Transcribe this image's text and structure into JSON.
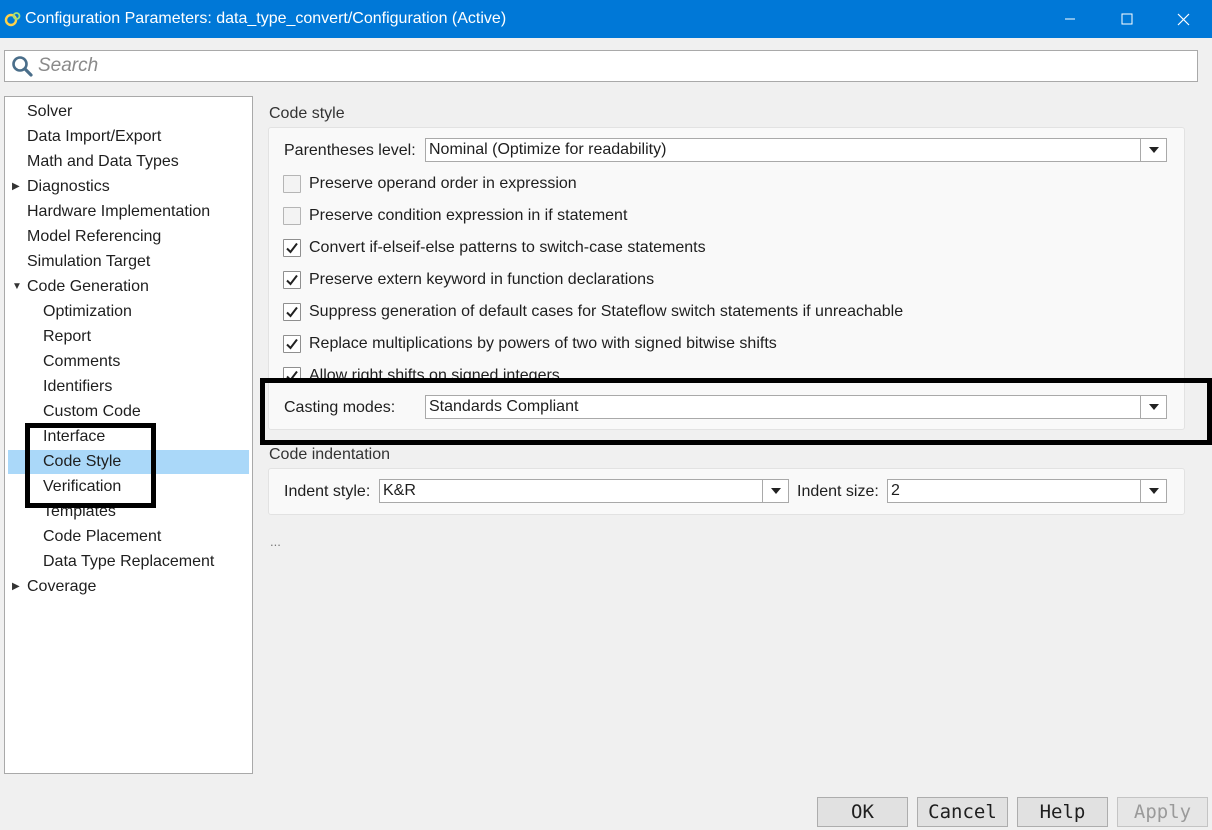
{
  "window": {
    "title": "Configuration Parameters: data_type_convert/Configuration (Active)",
    "minimize": "minimize",
    "maximize": "maximize",
    "close": "close"
  },
  "search": {
    "placeholder": "Search"
  },
  "tree": {
    "items": [
      {
        "label": "Solver"
      },
      {
        "label": "Data Import/Export"
      },
      {
        "label": "Math and Data Types"
      },
      {
        "label": "Diagnostics",
        "toggle": "▶"
      },
      {
        "label": "Hardware Implementation"
      },
      {
        "label": "Model Referencing"
      },
      {
        "label": "Simulation Target"
      },
      {
        "label": "Code Generation",
        "toggle": "▼"
      },
      {
        "label": "Optimization"
      },
      {
        "label": "Report"
      },
      {
        "label": "Comments"
      },
      {
        "label": "Identifiers"
      },
      {
        "label": "Custom Code"
      },
      {
        "label": "Interface"
      },
      {
        "label": "Code Style",
        "selected": true
      },
      {
        "label": "Verification"
      },
      {
        "label": "Templates"
      },
      {
        "label": "Code Placement"
      },
      {
        "label": "Data Type Replacement"
      },
      {
        "label": "Coverage",
        "toggle": "▶"
      }
    ]
  },
  "code_style": {
    "title": "Code style",
    "parentheses_label": "Parentheses level:",
    "parentheses_value": "Nominal (Optimize for readability)",
    "checkboxes": [
      {
        "label": "Preserve operand order in expression",
        "checked": false
      },
      {
        "label": "Preserve condition expression in if statement",
        "checked": false
      },
      {
        "label": "Convert if-elseif-else patterns to switch-case statements",
        "checked": true
      },
      {
        "label": "Preserve extern keyword in function declarations",
        "checked": true
      },
      {
        "label": "Suppress generation of default cases for Stateflow switch statements if unreachable",
        "checked": true
      },
      {
        "label": "Replace multiplications by powers of two with signed bitwise shifts",
        "checked": true
      },
      {
        "label": "Allow right shifts on signed integers",
        "checked": true
      }
    ],
    "casting_label": "Casting modes:",
    "casting_value": "Standards Compliant"
  },
  "code_indentation": {
    "title": "Code indentation",
    "indent_style_label": "Indent style:",
    "indent_style_value": "K&R",
    "indent_size_label": "Indent size:",
    "indent_size_value": "2"
  },
  "ellipsis": "...",
  "buttons": {
    "ok": "OK",
    "cancel": "Cancel",
    "help": "Help",
    "apply": "Apply"
  }
}
